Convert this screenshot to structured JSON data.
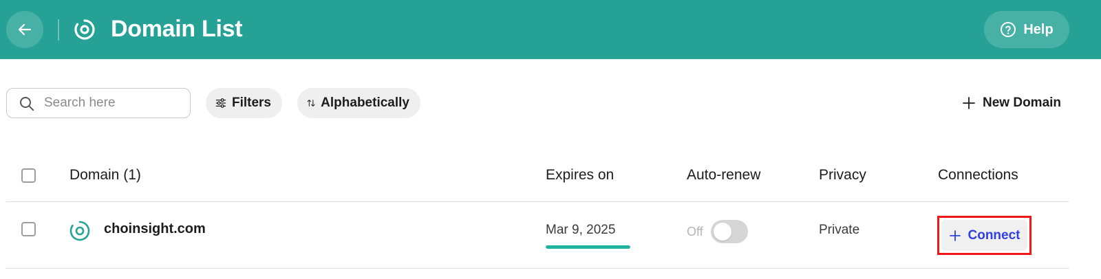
{
  "header": {
    "title": "Domain List",
    "help_label": "Help",
    "bg_color": "#25a295"
  },
  "toolbar": {
    "search_placeholder": "Search here",
    "filters_label": "Filters",
    "sort_label": "Alphabetically",
    "new_domain_label": "New Domain"
  },
  "table": {
    "columns": {
      "domain": "Domain (1)",
      "expires": "Expires on",
      "autorenew": "Auto-renew",
      "privacy": "Privacy",
      "connections": "Connections"
    },
    "rows": [
      {
        "domain": "choinsight.com",
        "expires": "Mar 9, 2025",
        "expiry_progress_pct": 100,
        "autorenew_label": "Off",
        "autorenew_on": false,
        "privacy": "Private",
        "connect_label": "Connect"
      }
    ]
  },
  "colors": {
    "accent": "#25a295",
    "connect_text": "#2f3fe0",
    "highlight": "#f21616",
    "expiry_bar": "#1eb4a2"
  },
  "icons": {
    "back": "arrow-left-icon",
    "logo": "target-ring-icon",
    "help": "question-circle-icon",
    "search": "search-icon",
    "filters": "sliders-icon",
    "sort": "sort-arrows-icon",
    "new": "plus-icon",
    "connect": "plus-icon"
  }
}
